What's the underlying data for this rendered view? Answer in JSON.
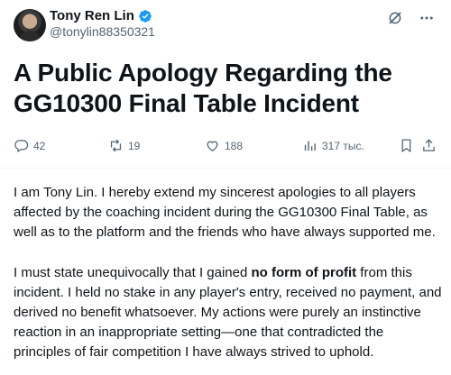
{
  "author": {
    "display_name": "Tony Ren Lin",
    "handle": "@tonylin88350321"
  },
  "post": {
    "title": "A Public Apology Regarding the GG10300 Final Table Incident",
    "paragraphs": [
      {
        "text": "I am Tony Lin. I hereby extend my sincerest apologies to all players affected by the coaching incident during the GG10300 Final Table, as well as to the platform and the friends who have always supported me."
      },
      {
        "before": "I must state unequivocally that I gained ",
        "bold": "no form of profit",
        "after": " from this incident. I held no stake in any player's entry, received no payment, and derived no benefit whatsoever. My actions were purely an instinctive reaction in an inappropriate setting—one that contradicted the principles of fair competition I have always strived to uphold."
      }
    ]
  },
  "stats": {
    "replies": "42",
    "reposts": "19",
    "likes": "188",
    "views": "317 тыс."
  },
  "colors": {
    "text": "#0f1419",
    "muted": "#536471",
    "verified": "#1d9bf0",
    "divider": "#eff3f4"
  },
  "icons": [
    "reply-icon",
    "repost-icon",
    "like-icon",
    "views-icon",
    "bookmark-icon",
    "share-icon",
    "grok-icon",
    "more-icon",
    "verified-badge-icon"
  ]
}
